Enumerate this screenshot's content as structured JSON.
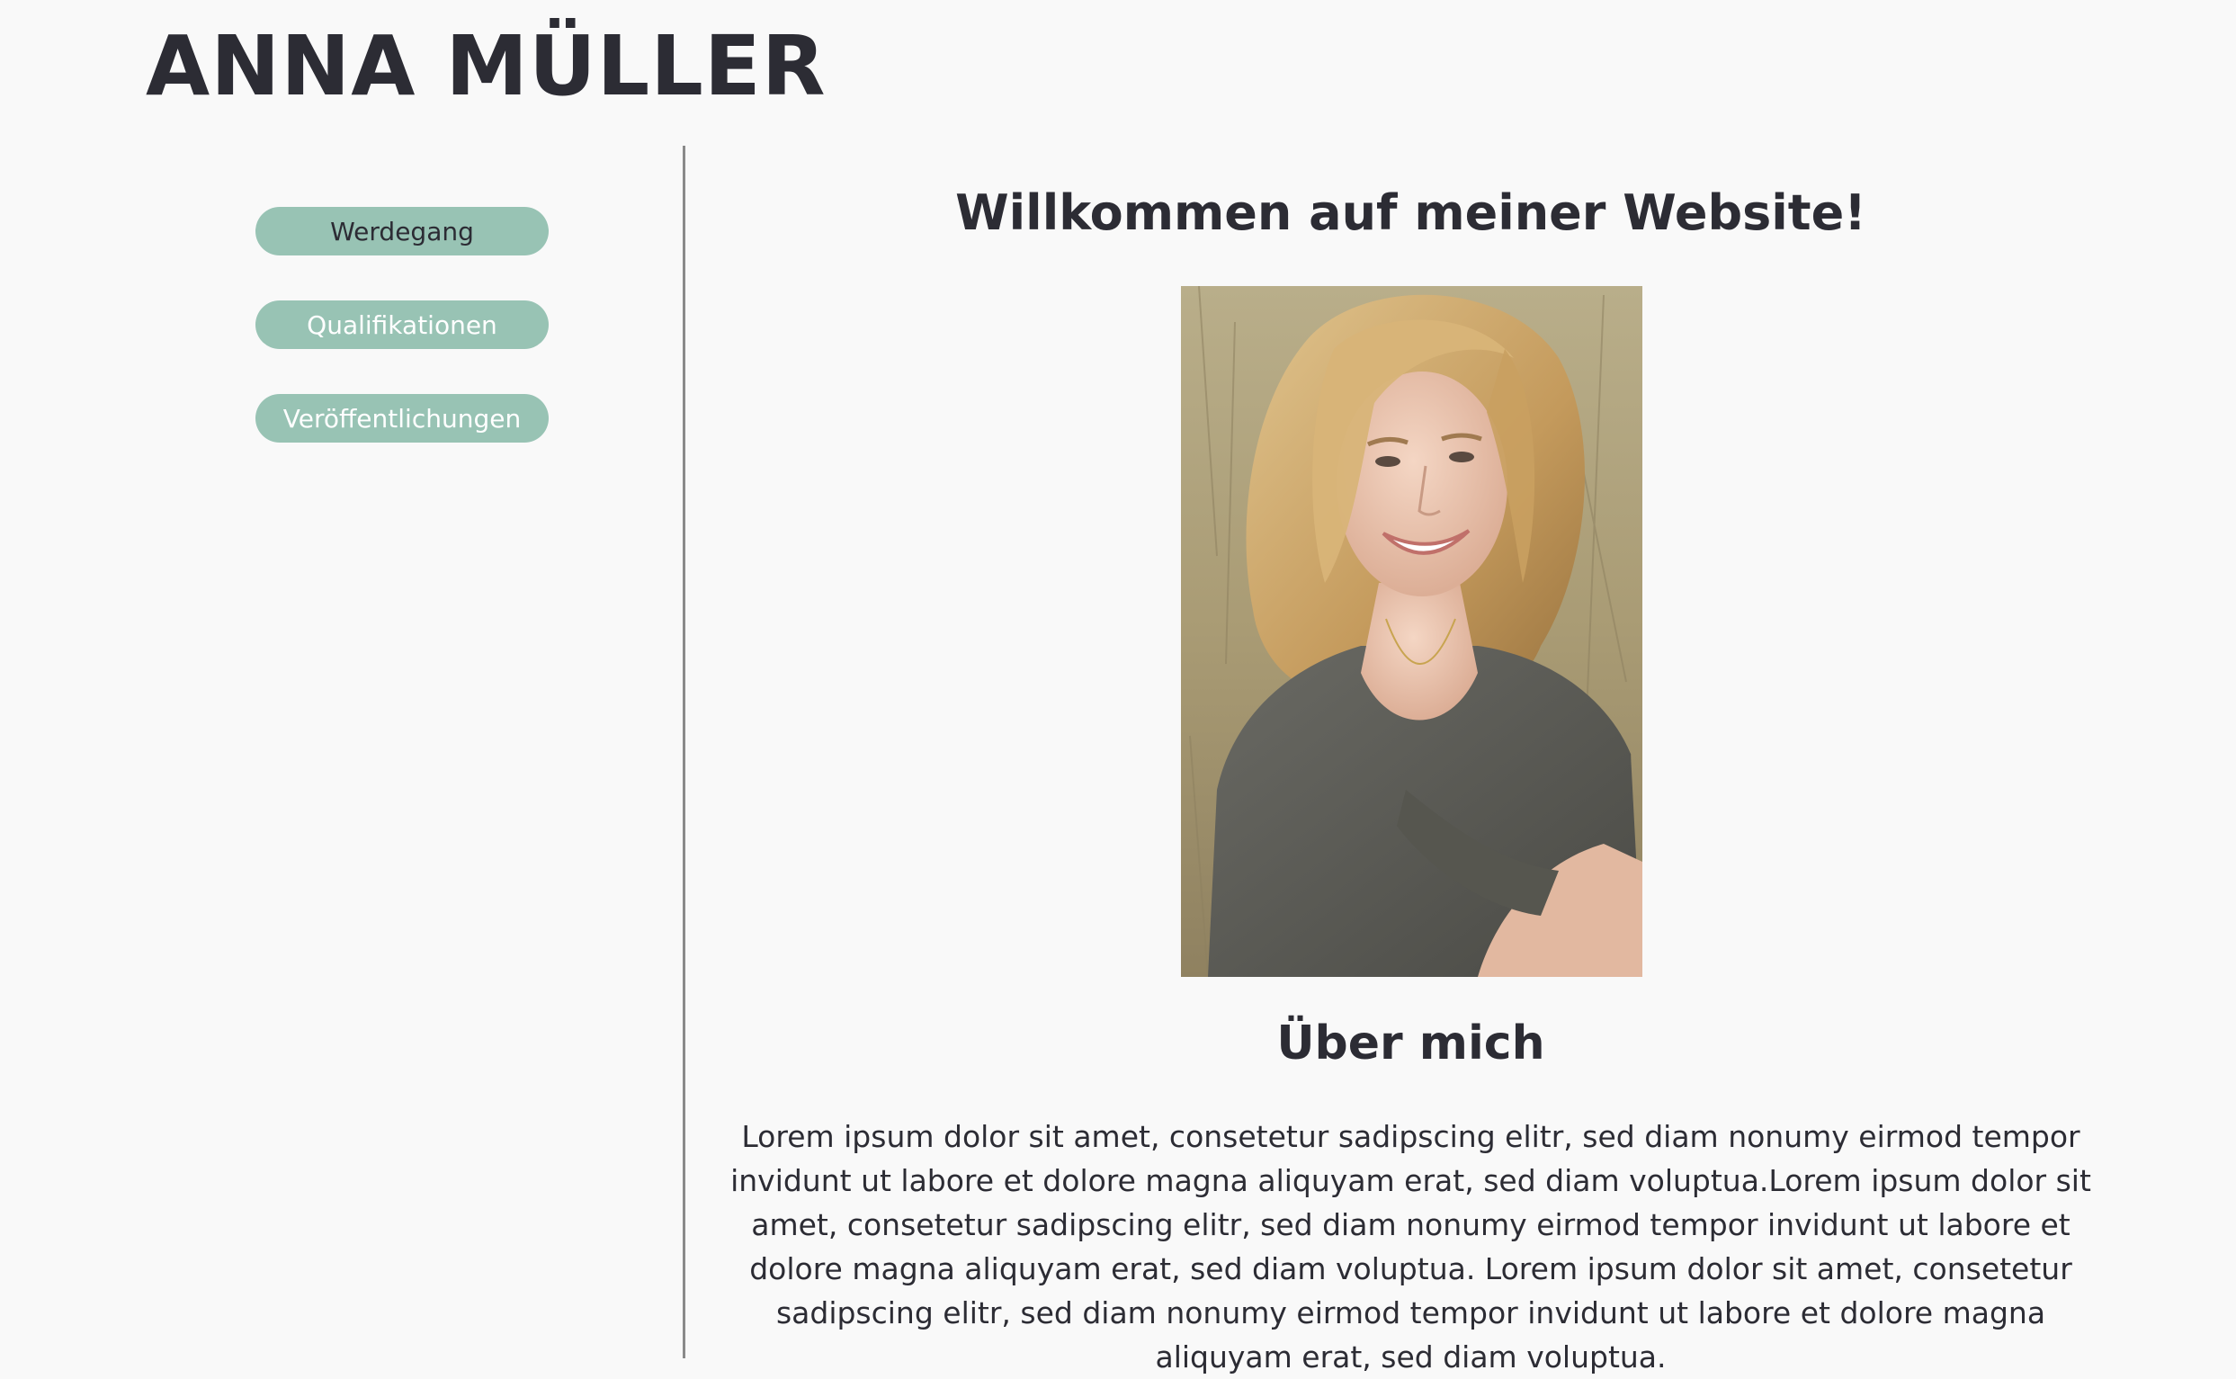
{
  "header": {
    "site_title": "ANNA MÜLLER"
  },
  "sidebar": {
    "items": [
      {
        "label": "Werdegang"
      },
      {
        "label": "Qualifikationen"
      },
      {
        "label": "Veröffentlichungen"
      }
    ]
  },
  "main": {
    "welcome_heading": "Willkommen auf meiner Website!",
    "portrait_alt": "",
    "about_heading": "Über mich",
    "about_text": "Lorem ipsum dolor sit amet, consetetur sadipscing elitr, sed diam nonumy eirmod tempor invidunt ut labore et dolore magna aliquyam erat, sed diam voluptua.Lorem ipsum dolor sit amet, consetetur sadipscing elitr, sed diam nonumy eirmod tempor invidunt ut labore et dolore magna aliquyam erat, sed diam voluptua. Lorem ipsum dolor sit amet, consetetur sadipscing elitr, sed diam nonumy eirmod tempor invidunt ut labore et dolore magna aliquyam erat, sed diam voluptua."
  },
  "colors": {
    "background": "#f9f9f9",
    "text": "#2c2c34",
    "nav_button": "#98c3b4",
    "divider": "#8a8a8a"
  }
}
